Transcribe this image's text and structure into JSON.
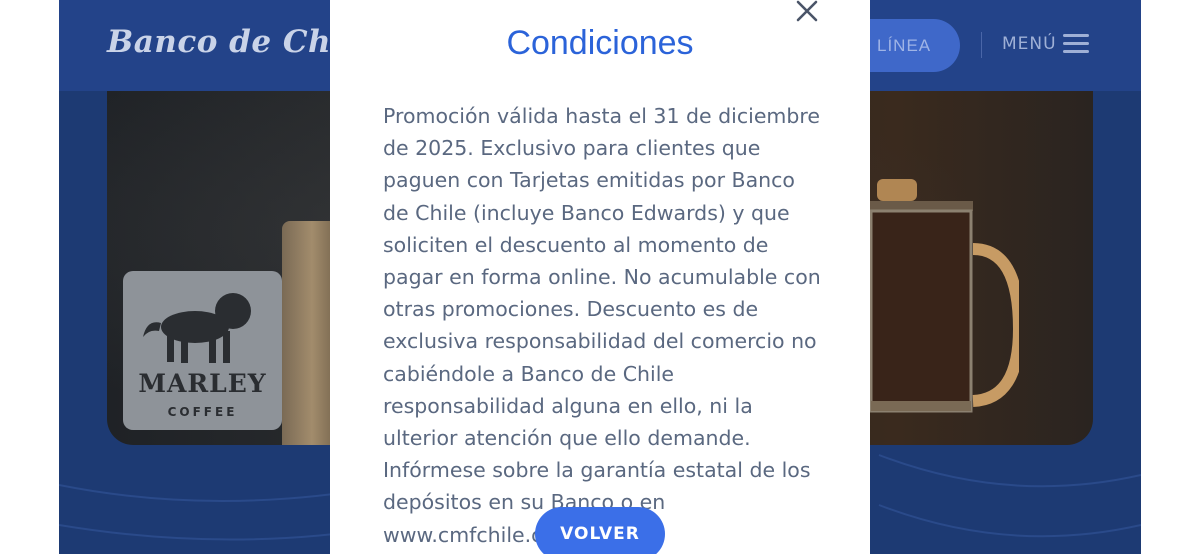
{
  "header": {
    "logo_text": "Banco de Chile",
    "online_button_label": "LÍNEA",
    "menu_label": "MENÚ"
  },
  "promo_card": {
    "brand": "MARLEY",
    "brand_sub": "COFFEE"
  },
  "modal": {
    "title": "Condiciones",
    "body": "Promoción válida hasta el 31 de diciembre de 2025. Exclusivo para clientes que paguen con Tarjetas emitidas por Banco de Chile (incluye Banco Edwards) y que soliciten el descuento al momento de pagar en forma online. No acumulable con otras promociones. Descuento es de exclusiva responsabilidad del comercio no cabiéndole a Banco de Chile responsabilidad alguna en ello, ni la ulterior atención que ello demande. Infórmese sobre la garantía estatal de los depósitos en su Banco o en www.cmfchile.cl",
    "button_label": "VOLVER",
    "close_icon": "close-icon"
  },
  "colors": {
    "page_bg": "#1d3a73",
    "header_bg": "#234389",
    "accent": "#2b63d9",
    "button": "#3b6fe8",
    "body_text": "#5a6880"
  }
}
